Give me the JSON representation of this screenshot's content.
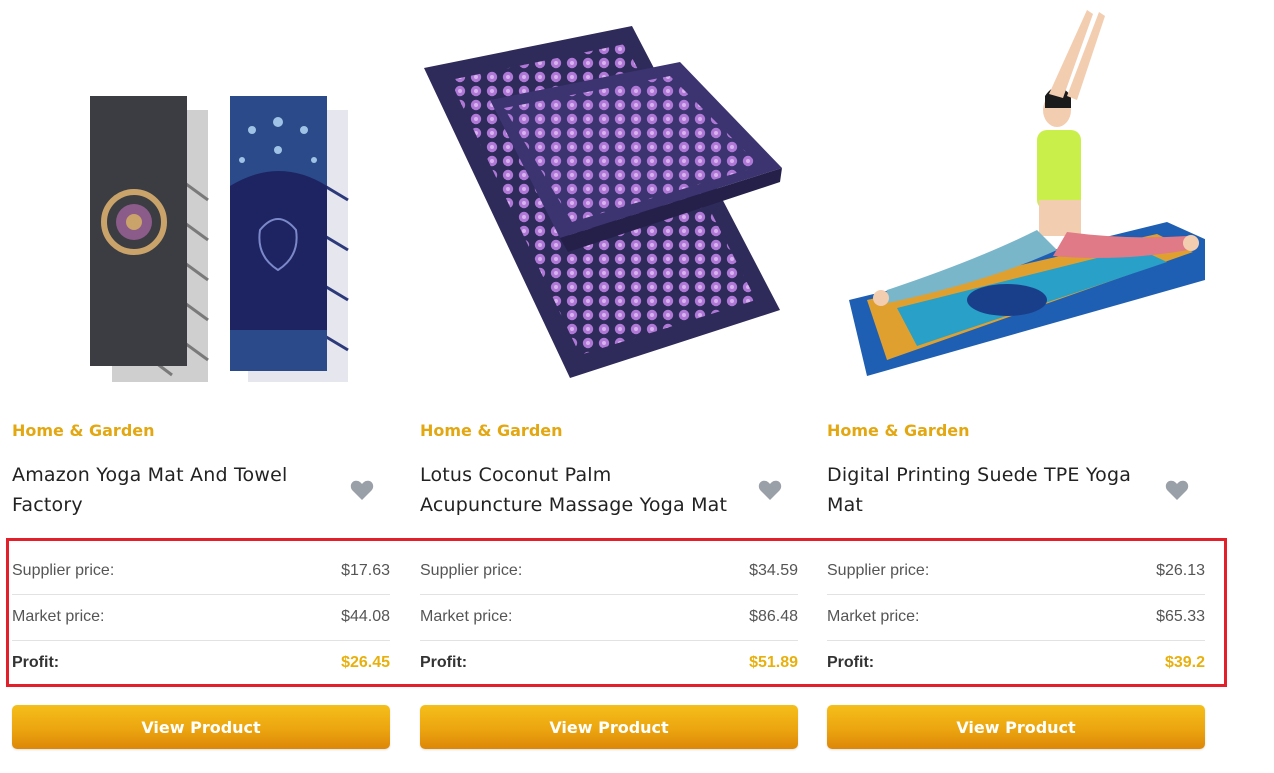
{
  "colors": {
    "accent": "#e3a712",
    "profit": "#e8b00e",
    "highlight": "#e3202a",
    "button": "#eca510"
  },
  "products": [
    {
      "category": "Home & Garden",
      "title": "Amazon Yoga Mat And Towel Factory",
      "image_icon": "yoga-mat-and-towel-image",
      "rows": [
        {
          "label": "Supplier price:",
          "value": "$17.63"
        },
        {
          "label": "Market price:",
          "value": "$44.08"
        },
        {
          "label": "Profit:",
          "value": "$26.45"
        }
      ],
      "button": "View Product"
    },
    {
      "category": "Home & Garden",
      "title": "Lotus Coconut Palm Acupuncture Massage Yoga Mat",
      "image_icon": "acupuncture-mat-image",
      "rows": [
        {
          "label": "Supplier price:",
          "value": "$34.59"
        },
        {
          "label": "Market price:",
          "value": "$86.48"
        },
        {
          "label": "Profit:",
          "value": "$51.89"
        }
      ],
      "button": "View Product"
    },
    {
      "category": "Home & Garden",
      "title": "Digital Printing Suede TPE Yoga Mat",
      "image_icon": "woman-on-yoga-mat-image",
      "rows": [
        {
          "label": "Supplier price:",
          "value": "$26.13"
        },
        {
          "label": "Market price:",
          "value": "$65.33"
        },
        {
          "label": "Profit:",
          "value": "$39.2"
        }
      ],
      "button": "View Product"
    }
  ]
}
